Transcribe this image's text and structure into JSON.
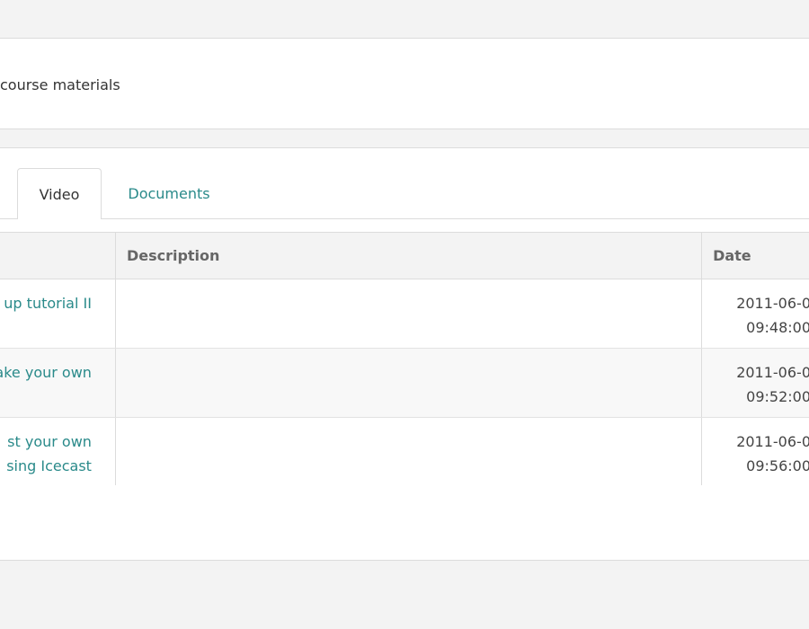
{
  "header": {
    "text": "course materials"
  },
  "tabs": [
    {
      "label": "Video",
      "active": true
    },
    {
      "label": "Documents",
      "active": false
    }
  ],
  "table": {
    "columns": [
      "",
      "Description",
      "Date"
    ],
    "rows": [
      {
        "title_line1": "up tutorial II",
        "title_line2": "",
        "description": "",
        "date_line1": "2011-06-0",
        "date_line2": "09:48:00"
      },
      {
        "title_line1": "ake your own",
        "title_line2": "",
        "description": "",
        "date_line1": "2011-06-0",
        "date_line2": "09:52:00"
      },
      {
        "title_line1": "st your own",
        "title_line2": "sing Icecast",
        "description": "",
        "date_line1": "2011-06-0",
        "date_line2": "09:56:00"
      }
    ]
  },
  "colors": {
    "link": "#2a8a8a",
    "background": "#f3f3f3",
    "border": "#dcdcdc"
  }
}
